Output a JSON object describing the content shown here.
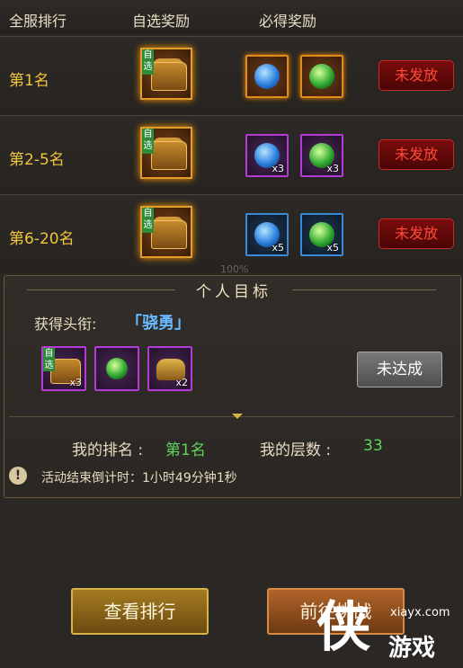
{
  "header": {
    "col1": "全服排行",
    "col2": "自选奖励",
    "col3": "必得奖励"
  },
  "rows": [
    {
      "rank": "第1名",
      "status": "未发放",
      "select_tag": "自选",
      "item1_count": "",
      "item2_count": ""
    },
    {
      "rank": "第2-5名",
      "status": "未发放",
      "select_tag": "自选",
      "item1_count": "x3",
      "item2_count": "x3"
    },
    {
      "rank": "第6-20名",
      "status": "未发放",
      "select_tag": "自选",
      "item1_count": "x5",
      "item2_count": "x5"
    }
  ],
  "scroll_percent": "100%",
  "goal": {
    "title": "个人目标",
    "title_label": "获得头衔:",
    "title_value": "「骁勇」",
    "items": [
      {
        "tag": "自选",
        "count": "x3"
      },
      {
        "tag": "",
        "count": ""
      },
      {
        "tag": "",
        "count": "x2"
      }
    ],
    "status_button": "未达成",
    "my_rank_label": "我的排名 :",
    "my_rank_value": "第1名",
    "my_floor_label": "我的层数 :",
    "my_floor_value": "33",
    "countdown": "活动结束倒计时：1小时49分钟1秒"
  },
  "buttons": {
    "view_rank": "查看排行",
    "go_challenge": "前往挑战"
  },
  "watermark": {
    "site": "xiayx.com",
    "brand_char": "侠",
    "brand_text": "游戏"
  },
  "colors": {
    "gold": "#f1c53c",
    "green": "#5fd35f",
    "blue_title": "#6ab8ff"
  }
}
